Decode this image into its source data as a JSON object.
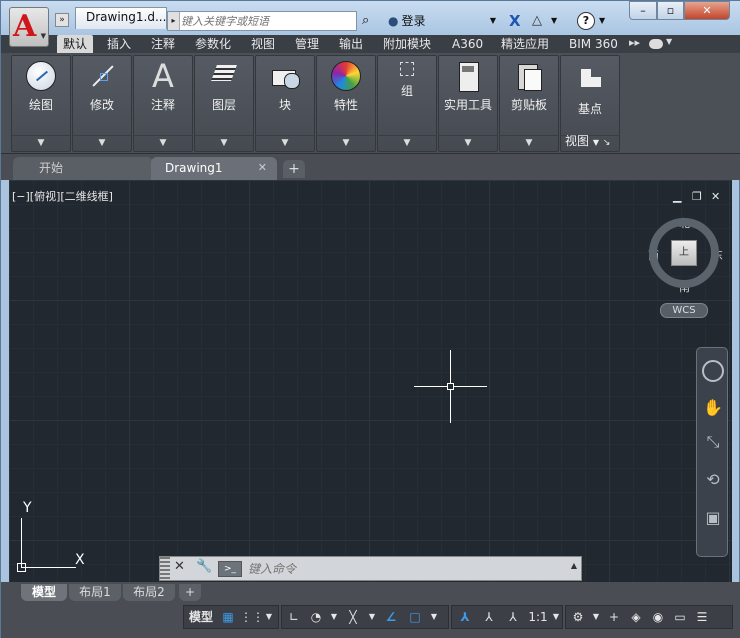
{
  "app": {
    "logo": "A",
    "document_tab": "Drawing1.d...",
    "search_placeholder": "键入关键字或短语",
    "login_label": "登录",
    "help_label": "?",
    "min_label": "–",
    "max_label": "▫",
    "close_label": "✕"
  },
  "ribbon_tabs": [
    {
      "label": "默认",
      "active": true
    },
    {
      "label": "插入"
    },
    {
      "label": "注释"
    },
    {
      "label": "参数化"
    },
    {
      "label": "视图"
    },
    {
      "label": "管理"
    },
    {
      "label": "输出"
    },
    {
      "label": "附加模块"
    },
    {
      "label": "A360"
    },
    {
      "label": "精选应用"
    },
    {
      "label": "BIM 360"
    }
  ],
  "panels": {
    "draw": "绘图",
    "modify": "修改",
    "annotation": "注释",
    "layers": "图层",
    "block": "块",
    "properties": "特性",
    "group": "组",
    "utilities": "实用工具",
    "clipboard": "剪贴板",
    "basepoint": "基点",
    "view": "视图"
  },
  "annotation_glyph": "A",
  "doc_tabs": {
    "start": "开始",
    "current": "Drawing1"
  },
  "viewport": {
    "label": "[−][俯视][二维线框]",
    "viewcube_face": "上",
    "north": "北",
    "south": "南",
    "east": "东",
    "west": "西",
    "wcs": "WCS"
  },
  "ucs": {
    "x": "X",
    "y": "Y"
  },
  "command": {
    "placeholder": "键入命令"
  },
  "layout_tabs": [
    {
      "label": "模型",
      "active": true
    },
    {
      "label": "布局1"
    },
    {
      "label": "布局2"
    }
  ],
  "status": {
    "model": "模型",
    "scale": "1:1"
  },
  "colors": {
    "canvas": "#212830",
    "accent_red": "#d0161b",
    "accent_blue": "#3d9be9"
  }
}
